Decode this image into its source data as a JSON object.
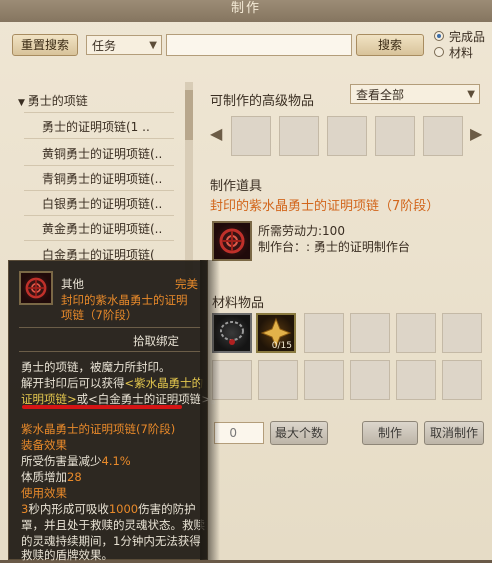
{
  "window": {
    "title": "制作"
  },
  "toolbar": {
    "reset_search_label": "重置搜索",
    "filter_value": "任务",
    "search_placeholder": "",
    "search_label": "搜索",
    "radio_completed": "完成品",
    "radio_material": "材料"
  },
  "tree": {
    "category": "勇士的项链",
    "items": [
      "勇士的证明项链(1 ..",
      "黄铜勇士的证明项链(..",
      "青铜勇士的证明项链(..",
      "白银勇士的证明项链(..",
      "黄金勇士的证明项链(..",
      "白金勇士的证明项链("
    ]
  },
  "advanced": {
    "title": "可制作的高级物品",
    "view_value": "查看全部"
  },
  "craft": {
    "section_label": "制作道具",
    "item_name": "封印的紫水晶勇士的证明项链（7阶段）",
    "labor": "所需劳动力:100",
    "station": "制作台：: 勇士的证明制作台"
  },
  "materials": {
    "section_label": "材料物品",
    "slot2_count": "0/15"
  },
  "bottom": {
    "quantity": "0",
    "max_label": "最大个数",
    "craft_label": "制作",
    "cancel_label": "取消制作"
  },
  "tooltip": {
    "category": "其他",
    "quality": "完美",
    "name_line1": "封印的紫水晶勇士的证明",
    "name_line2": "项链（7阶段）",
    "bind": "拾取绑定",
    "desc1": "勇士的项链，被魔力所封印。",
    "desc2a": "解开封印后可以获得",
    "desc2b": "<紫水晶勇士的",
    "desc3a": "证明项链>",
    "desc3b": "或<白金勇士的证明项链>。",
    "result_name": "紫水晶勇士的证明项链(7阶段)",
    "equip_header": "装备效果",
    "effect1a": "所受伤害量减少",
    "effect1b": "4.1%",
    "effect2a": "体质增加",
    "effect2b": "28",
    "use_header": "使用效果",
    "use1a": "3",
    "use1b": "秒内形成可吸收",
    "use1c": "1000",
    "use1d": "伤害的防护",
    "use2": "罩，并且处于救赎的灵魂状态。救赎",
    "use3": "的灵魂持续期间，1分钟内无法获得",
    "use4": "救赎的盾牌效果。"
  },
  "colors": {
    "accent_orange": "#d2661c",
    "tooltip_bg": "#1e1a14",
    "highlight_red": "#d41414"
  }
}
